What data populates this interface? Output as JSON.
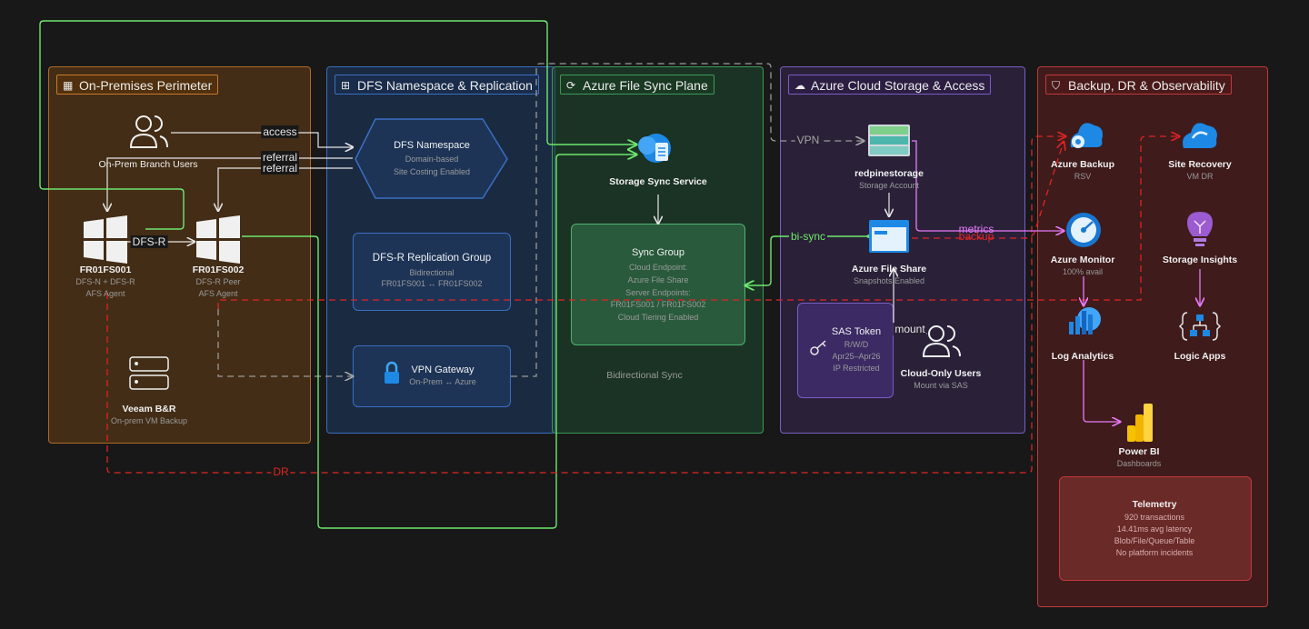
{
  "zones": {
    "onprem": {
      "title": "On-Premises Perimeter"
    },
    "dfs": {
      "title": "DFS Namespace & Replication"
    },
    "afs": {
      "title": "Azure File Sync Plane"
    },
    "azure": {
      "title": "Azure Cloud Storage & Access"
    },
    "backup": {
      "title": "Backup, DR & Observability"
    }
  },
  "nodes": {
    "branch_users": {
      "name": "On-Prem Branch Users"
    },
    "fs1": {
      "name": "FR01FS001",
      "sub1": "DFS-N + DFS-R",
      "sub2": "AFS Agent"
    },
    "fs2": {
      "name": "FR01FS002",
      "sub1": "DFS-R Peer",
      "sub2": "AFS Agent"
    },
    "veeam": {
      "name": "Veeam B&R",
      "sub1": "On-prem VM Backup"
    },
    "dfs_ns": {
      "name": "DFS Namespace",
      "sub1": "Domain-based",
      "sub2": "Site Costing Enabled"
    },
    "dfsr_group": {
      "name": "DFS-R Replication Group",
      "sub1": "Bidirectional",
      "sub2": "FR01FS001 ↔ FR01FS002"
    },
    "vpn_gw": {
      "name": "VPN Gateway",
      "sub1": "On-Prem ↔ Azure"
    },
    "sync_service": {
      "name": "Storage Sync Service"
    },
    "sync_group": {
      "name": "Sync Group",
      "l1": "Cloud Endpoint:",
      "l2": "Azure File Share",
      "l3": "Server Endpoints:",
      "l4": "FR01FS001 / FR01FS002",
      "l5": "Cloud Tiering Enabled"
    },
    "bidir_note": "Bidirectional Sync",
    "storage_acct": {
      "name": "redpinestorage",
      "sub1": "Storage Account"
    },
    "file_share": {
      "name": "Azure File Share",
      "sub1": "Snapshots Enabled"
    },
    "sas": {
      "name": "SAS Token",
      "sub1": "R/W/D",
      "sub2": "Apr25–Apr26",
      "sub3": "IP Restricted"
    },
    "cloud_users": {
      "name": "Cloud-Only Users",
      "sub1": "Mount via SAS"
    },
    "azure_backup": {
      "name": "Azure Backup",
      "sub1": "RSV"
    },
    "site_recovery": {
      "name": "Site Recovery",
      "sub1": "VM DR"
    },
    "azure_monitor": {
      "name": "Azure Monitor",
      "sub1": "100% avail"
    },
    "storage_insights": {
      "name": "Storage Insights"
    },
    "log_analytics": {
      "name": "Log Analytics"
    },
    "logic_apps": {
      "name": "Logic Apps"
    },
    "power_bi": {
      "name": "Power BI",
      "sub1": "Dashboards"
    },
    "telemetry": {
      "name": "Telemetry",
      "l1": "920 transactions",
      "l2": "14.41ms avg latency",
      "l3": "Blob/File/Queue/Table",
      "l4": "No platform incidents"
    }
  },
  "edges": {
    "access": "access",
    "referral1": "referral",
    "referral2": "referral",
    "dfsr": "DFS-R",
    "vpn": "VPN",
    "bisync": "bi-sync",
    "mount": "mount",
    "metrics": "metrics",
    "backup": "backup",
    "dr": "DR"
  },
  "colors": {
    "onprem": "#e8903a",
    "dfs": "#3b82f6",
    "afs": "#4ade80",
    "azure": "#8b5cf6",
    "backup": "#ef4444",
    "green_edge": "#6ee76e",
    "red_edge": "#e02424",
    "pink_edge": "#e879f9",
    "white_edge": "#e5e5e5"
  },
  "icons": [
    "building-icon",
    "tree-icon",
    "sync-icon",
    "cloud-icon",
    "shield-icon",
    "users-icon",
    "windows-icon",
    "server-icon",
    "lock-icon",
    "key-icon",
    "storage-icon",
    "fileshare-icon",
    "cloud-backup-icon",
    "cloud-recovery-icon",
    "gauge-icon",
    "bulb-icon",
    "log-icon",
    "logic-icon",
    "powerbi-icon"
  ]
}
